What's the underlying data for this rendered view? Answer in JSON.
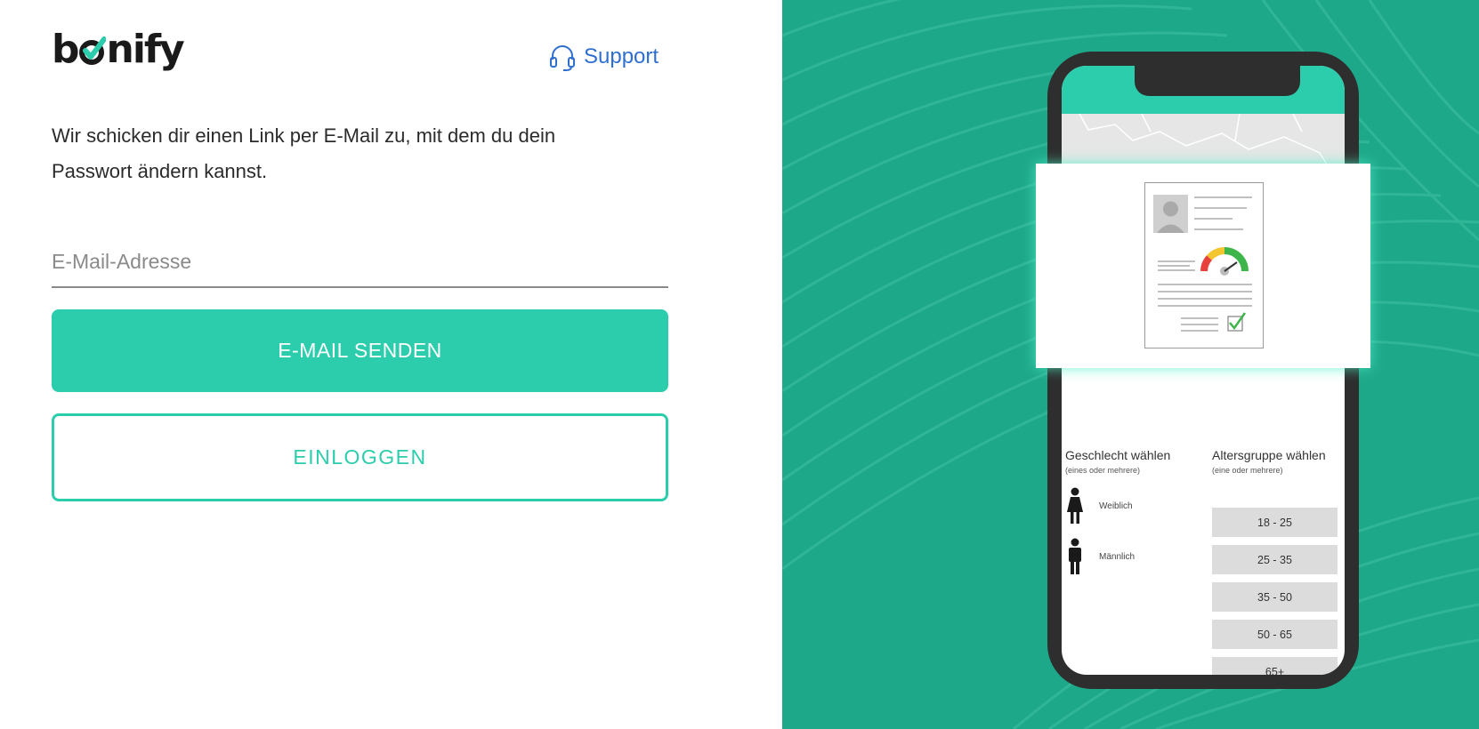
{
  "brand": {
    "logo_prefix": "b",
    "logo_suffix": "nify"
  },
  "header": {
    "support_label": "Support"
  },
  "form": {
    "intro_text": "Wir schicken dir einen Link per E-Mail zu, mit dem du dein Passwort ändern kannst.",
    "email_placeholder": "E-Mail-Adresse",
    "email_value": "",
    "submit_label": "E-MAIL SENDEN",
    "login_label": "EINLOGGEN"
  },
  "illustration": {
    "gender_heading": "Geschlecht wählen",
    "gender_sub": "(eines oder mehrere)",
    "age_heading": "Altersgruppe wählen",
    "age_sub": "(eine oder mehrere)",
    "genders": [
      "Weiblich",
      "Männlich"
    ],
    "age_groups": [
      "18 - 25",
      "25 - 35",
      "35 - 50",
      "50 - 65",
      "65+"
    ]
  },
  "colors": {
    "accent": "#2ccdac",
    "panel": "#1ea88a",
    "link": "#2f6fd0",
    "phone": "#2e2e2e"
  },
  "icons": {
    "support": "headset-icon",
    "logo_mark": "checkmark-icon"
  }
}
